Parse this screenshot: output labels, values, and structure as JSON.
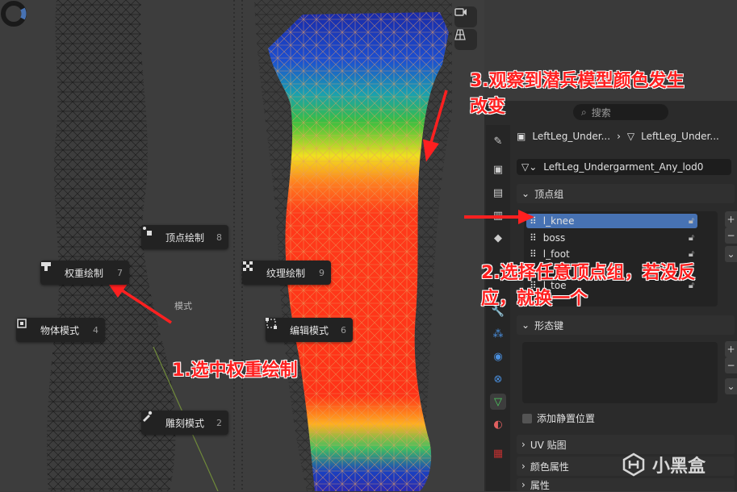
{
  "viewport": {
    "pie_menu": {
      "title": "模式",
      "items": [
        {
          "label": "顶点绘制",
          "num": "8"
        },
        {
          "label": "权重绘制",
          "num": "7"
        },
        {
          "label": "纹理绘制",
          "num": "9"
        },
        {
          "label": "物体模式",
          "num": "4"
        },
        {
          "label": "编辑模式",
          "num": "6"
        },
        {
          "label": "雕刻模式",
          "num": "2"
        }
      ]
    }
  },
  "annotations": {
    "step1": "1.选中权重绘制",
    "step2_line1": "2.选择任意顶点组，若没反",
    "step2_line2": "应，就换一个",
    "step3_line1": "3.观察到潜兵模型颜色发生",
    "step3_line2": "改变"
  },
  "props": {
    "search_placeholder": "搜索",
    "breadcrumb_object": "LeftLeg_Under...",
    "breadcrumb_mesh": "LeftLeg_Under...",
    "mesh_name": "LeftLeg_Undergarment_Any_lod0",
    "vertex_groups_title": "顶点组",
    "vertex_groups": [
      "l_knee",
      "boss",
      "l_foot",
      "l_toe"
    ],
    "shape_keys_title": "形态键",
    "relative_to_rest": "添加静置位置",
    "uv_title": "UV 贴图",
    "color_attr_title": "颜色属性",
    "attributes_title": "属性"
  },
  "watermark": "小黑盒",
  "colors": {
    "annotation": "#ff2020",
    "selection": "#4772b3",
    "panel_bg": "#2b2b2b"
  }
}
